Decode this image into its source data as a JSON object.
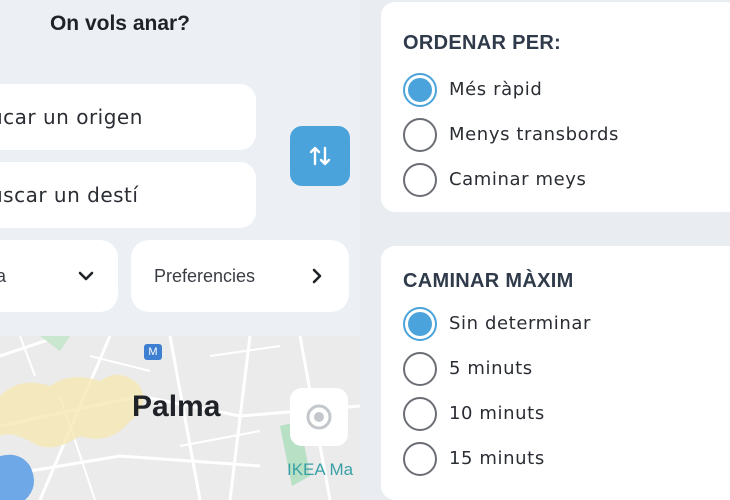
{
  "left": {
    "title": "On vols anar?",
    "origin_placeholder": "ucar un origen",
    "destination_placeholder": "uscar un destí",
    "option_pill_label": "a",
    "preferences_label": "Preferencies",
    "map": {
      "city_label": "Palma",
      "poi_label": "IKEA Ma",
      "metro_icon": "metro-icon"
    }
  },
  "sort": {
    "title": "ORDENAR PER:",
    "options": [
      {
        "label": "Més ràpid",
        "selected": true
      },
      {
        "label": "Menys transbords",
        "selected": false
      },
      {
        "label": "Caminar meys",
        "selected": false
      }
    ]
  },
  "walk": {
    "title": "CAMINAR MÀXIM",
    "options": [
      {
        "label": "Sin determinar",
        "selected": true
      },
      {
        "label": "5 minuts",
        "selected": false
      },
      {
        "label": "10 minuts",
        "selected": false
      },
      {
        "label": "15 minuts",
        "selected": false
      }
    ]
  },
  "colors": {
    "accent": "#4aa3db",
    "background": "#eceff3"
  }
}
